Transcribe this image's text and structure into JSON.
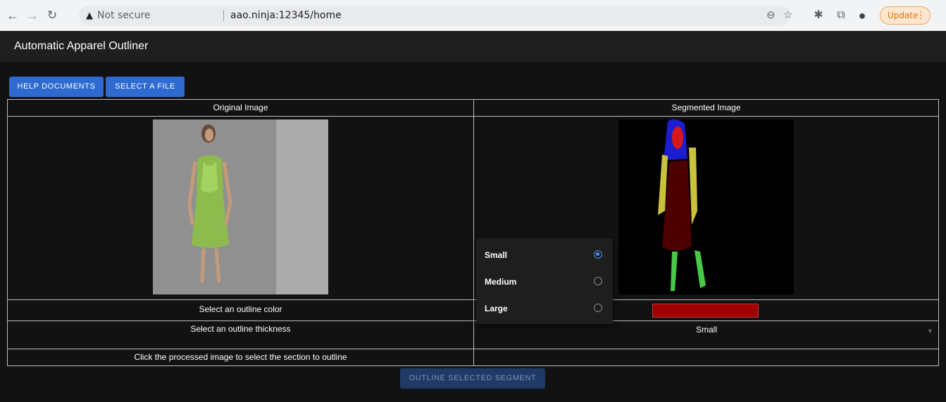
{
  "browser": {
    "url_security": "Not secure",
    "url": "aao.ninja:12345/home",
    "update_label": "Update"
  },
  "app": {
    "title": "Automatic Apparel Outliner",
    "help_button": "HELP DOCUMENTS",
    "select_file_button": "SELECT A FILE",
    "original_header": "Original Image",
    "segmented_header": "Segmented Image",
    "color_label": "Select an outline color",
    "outline_color": "#a10000",
    "thickness_label": "Select an outline thickness",
    "thickness_value": "Small",
    "instruction": "Click the processed image to select the section to outline",
    "outline_button": "OUTLINE SELECTED SEGMENT"
  },
  "thickness_menu": {
    "options": [
      {
        "label": "Small",
        "selected": true
      },
      {
        "label": "Medium",
        "selected": false
      },
      {
        "label": "Large",
        "selected": false
      }
    ]
  },
  "icons": [
    "back-arrow-icon",
    "forward-arrow-icon",
    "reload-icon",
    "warning-icon",
    "zoom-icon",
    "star-icon",
    "extensions-icon",
    "cast-icon",
    "profile-icon",
    "more-icon"
  ]
}
